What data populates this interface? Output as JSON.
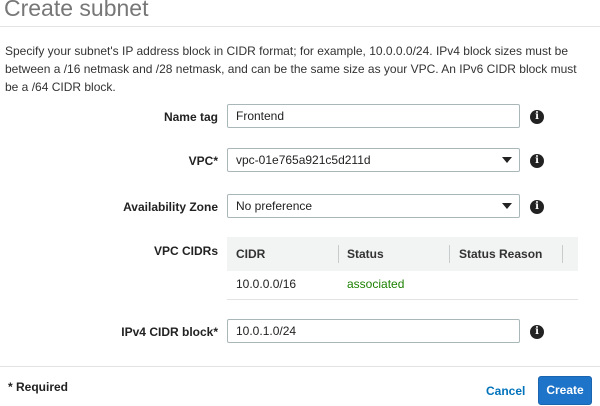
{
  "page": {
    "title": "Create subnet",
    "description": "Specify your subnet's IP address block in CIDR format; for example, 10.0.0.0/24. IPv4 block sizes must be between a /16 netmask and /28 netmask, and can be the same size as your VPC. An IPv6 CIDR block must be a /64 CIDR block."
  },
  "form": {
    "name_tag": {
      "label": "Name tag",
      "value": "Frontend"
    },
    "vpc": {
      "label": "VPC*",
      "value": "vpc-01e765a921c5d211d"
    },
    "availability_zone": {
      "label": "Availability Zone",
      "value": "No preference"
    },
    "vpc_cidrs": {
      "label": "VPC CIDRs",
      "columns": [
        "CIDR",
        "Status",
        "Status Reason"
      ],
      "rows": [
        {
          "cidr": "10.0.0.0/16",
          "status": "associated",
          "status_reason": ""
        }
      ]
    },
    "ipv4_cidr_block": {
      "label": "IPv4 CIDR block*",
      "value": "10.0.1.0/24"
    }
  },
  "icons": {
    "info": "info-icon",
    "info_glyph": "i",
    "dropdown": "chevron-down-icon"
  },
  "footer": {
    "required_note": "* Required",
    "cancel_label": "Cancel",
    "create_label": "Create"
  },
  "colors": {
    "primary_button": "#1e74c8",
    "link": "#0073bb",
    "status_associated": "#1d8102"
  }
}
